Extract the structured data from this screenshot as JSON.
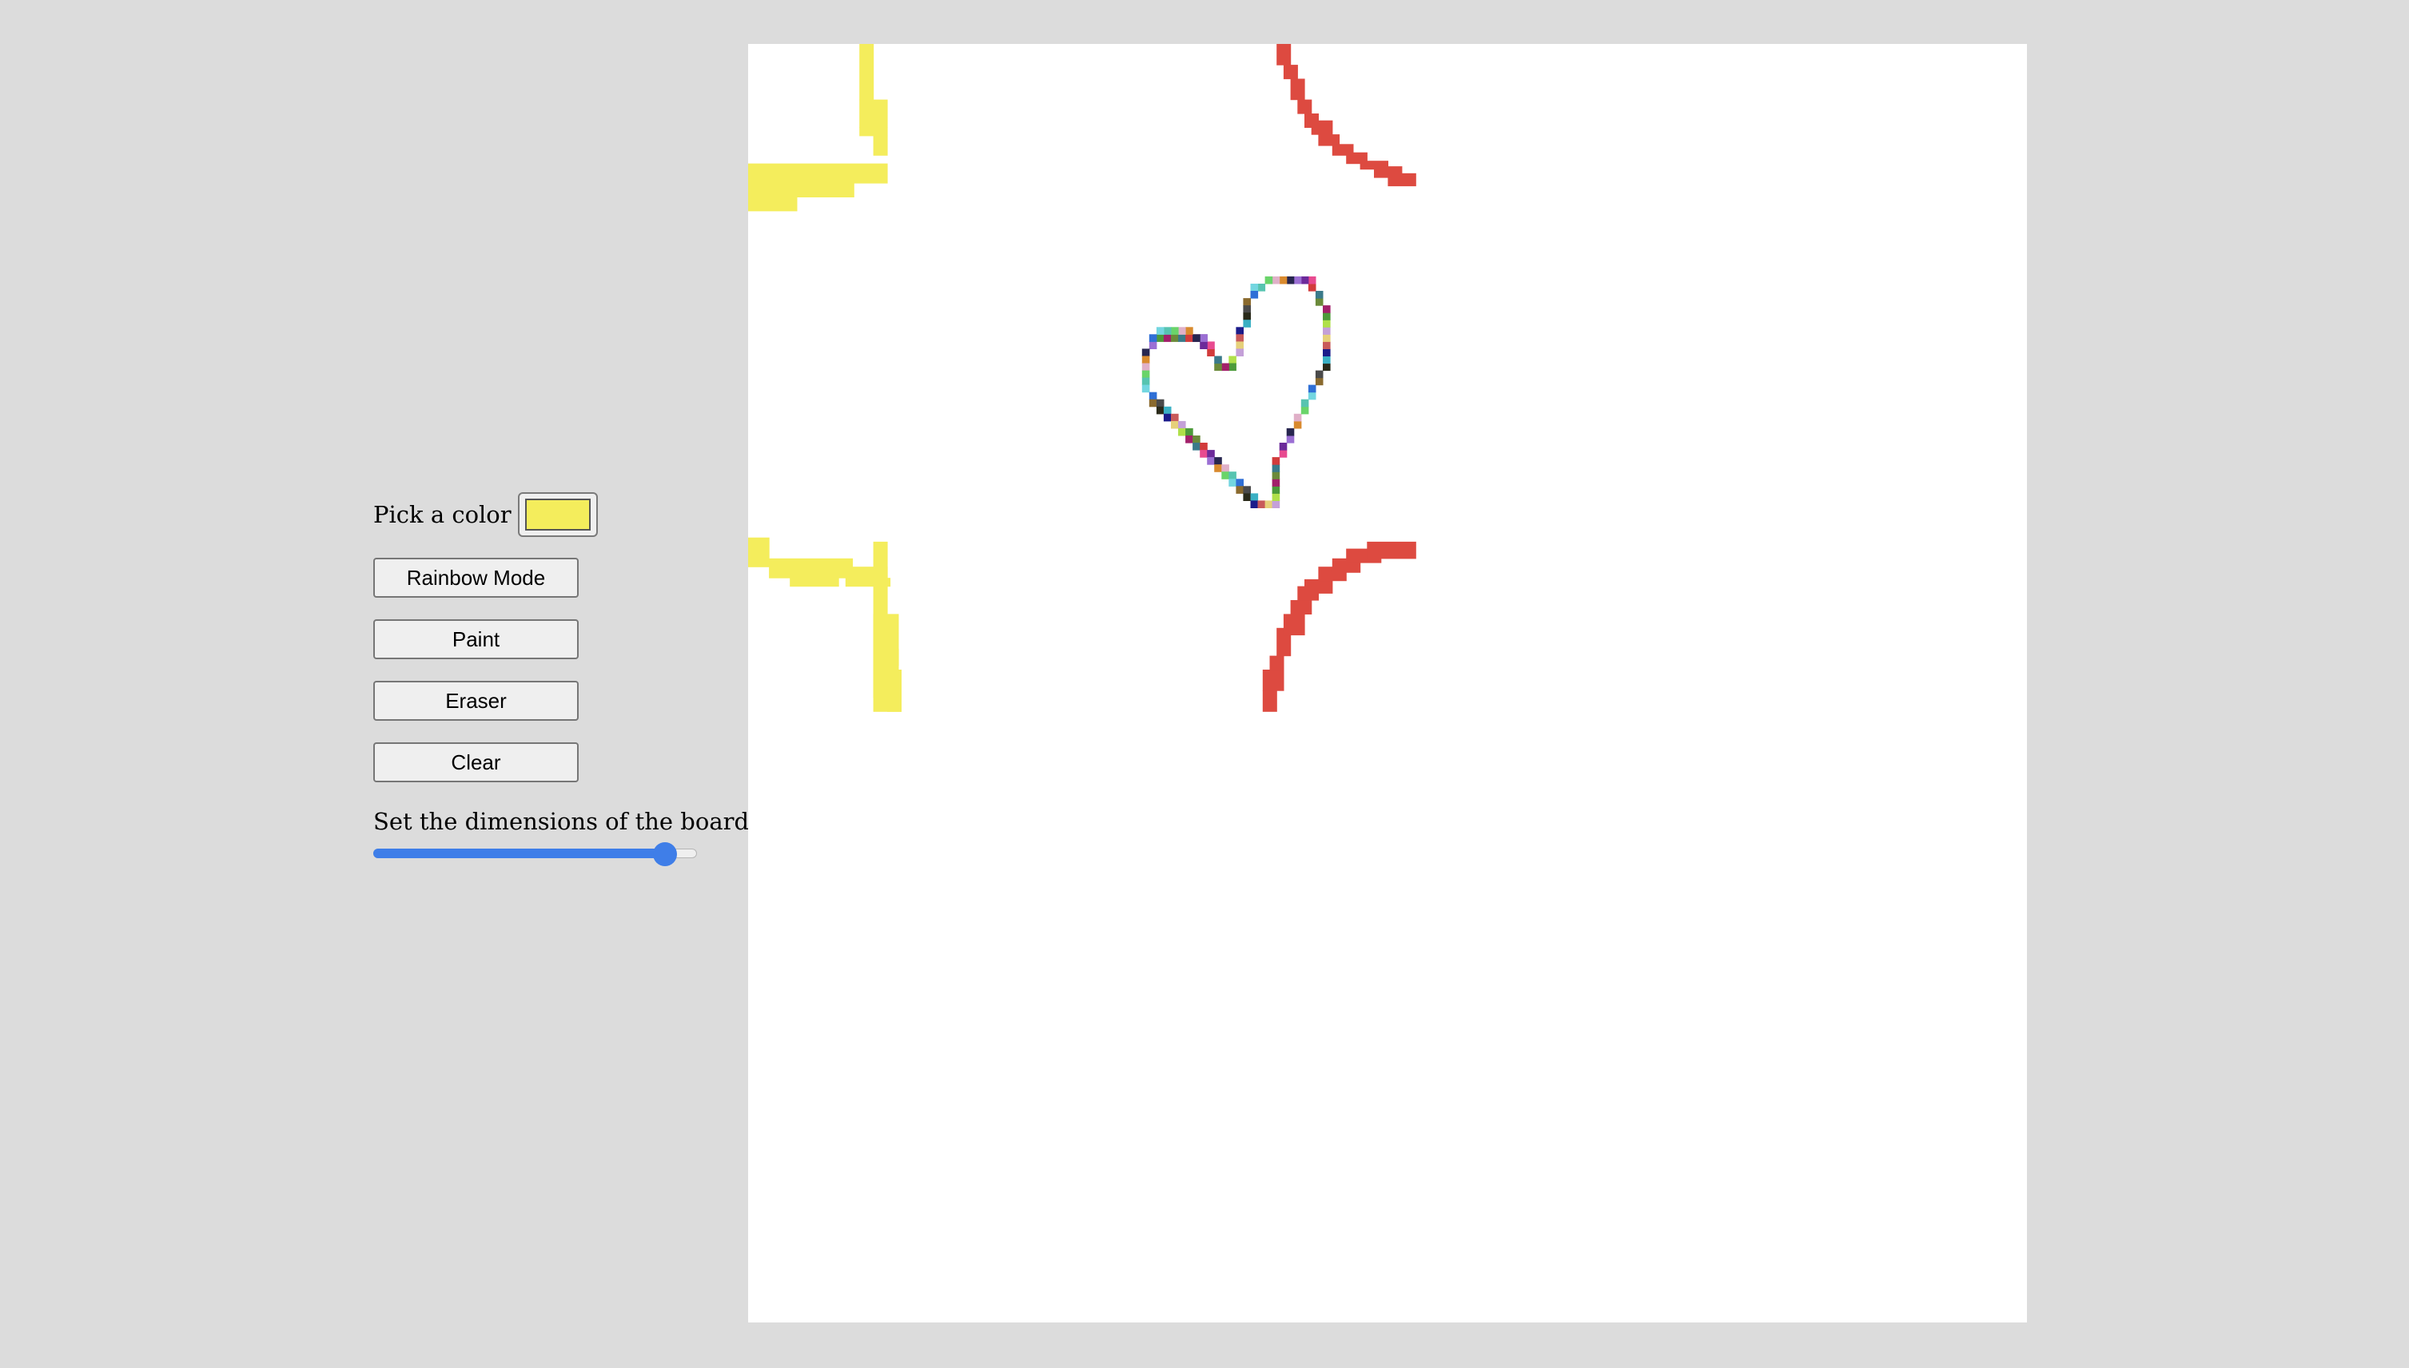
{
  "controls": {
    "pick_color_label": "Pick a color",
    "current_color": "#f4ed5c",
    "buttons": {
      "rainbow": "Rainbow Mode",
      "paint": "Paint",
      "eraser": "Eraser",
      "clear": "Clear"
    },
    "dimensions_label": "Set the dimensions of the board",
    "dimensions_slider_fraction": 0.9
  },
  "board": {
    "background": "#ffffff",
    "yellow_color": "#f4ed5c",
    "red_color": "#dd4a40",
    "heart_colors": [
      "#4c9a3a",
      "#9b6fd4",
      "#2f6fd6",
      "#e6d07a",
      "#d23b3b",
      "#6ad46a",
      "#3ab0c4",
      "#a2206a",
      "#27264f",
      "#8a6a2e",
      "#c4a0d8",
      "#e84a90",
      "#57c4b0",
      "#1b1b8a",
      "#6b8a3a",
      "#d98a2e",
      "#4a4a4a",
      "#b0e04a",
      "#6c2a9a",
      "#73d6e0",
      "#c85a5a",
      "#3a7a8a",
      "#e0b0c8",
      "#2a2a1a"
    ]
  }
}
